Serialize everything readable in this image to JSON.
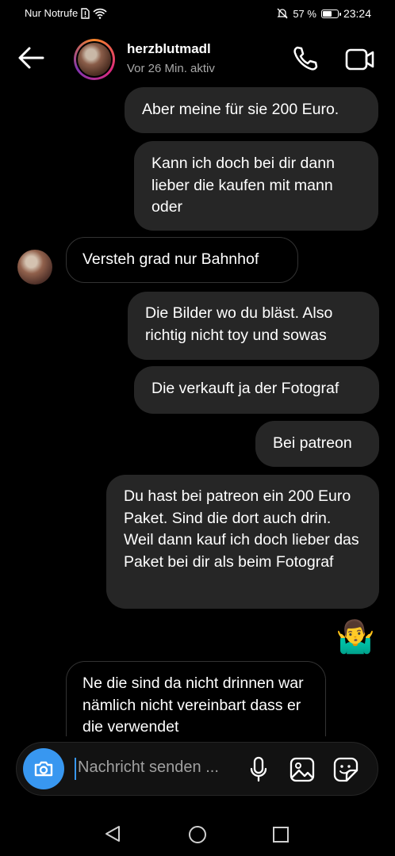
{
  "status_bar": {
    "carrier": "Nur Notrufe",
    "battery": "57 %",
    "battery_level": 0.57,
    "time": "23:24"
  },
  "header": {
    "username": "herzblutmadl",
    "activity": "Vor 26 Min. aktiv"
  },
  "messages": [
    {
      "direction": "outgoing",
      "text": "Aber meine für sie 200 Euro."
    },
    {
      "direction": "outgoing",
      "text": "Kann ich doch bei dir dann lieber die kaufen mit mann oder"
    },
    {
      "direction": "incoming",
      "text": "Versteh grad nur Bahnhof"
    },
    {
      "direction": "outgoing",
      "text": "Die Bilder wo du bläst. Also richtig nicht toy und sowas"
    },
    {
      "direction": "outgoing",
      "text": "Die verkauft ja der Fotograf"
    },
    {
      "direction": "outgoing",
      "text": "Bei patreon"
    },
    {
      "direction": "outgoing",
      "text": "Du hast bei patreon ein 200 Euro Paket. Sind die dort auch drin. Weil dann kauf ich doch lieber das Paket bei dir als beim Fotograf"
    },
    {
      "direction": "outgoing",
      "text": "🤷‍♂️"
    },
    {
      "direction": "incoming",
      "text": "Ne die sind da nicht drinnen war nämlich nicht vereinbart dass er die verwendet"
    }
  ],
  "composer": {
    "placeholder": "Nachricht senden ..."
  },
  "colors": {
    "accent": "#3897f0",
    "outgoing_bubble": "#262626",
    "background": "#000000"
  },
  "icons": [
    "back-arrow-icon",
    "phone-icon",
    "video-camera-icon",
    "camera-icon",
    "microphone-icon",
    "gallery-icon",
    "sticker-icon",
    "nav-back-icon",
    "nav-home-icon",
    "nav-recents-icon"
  ]
}
